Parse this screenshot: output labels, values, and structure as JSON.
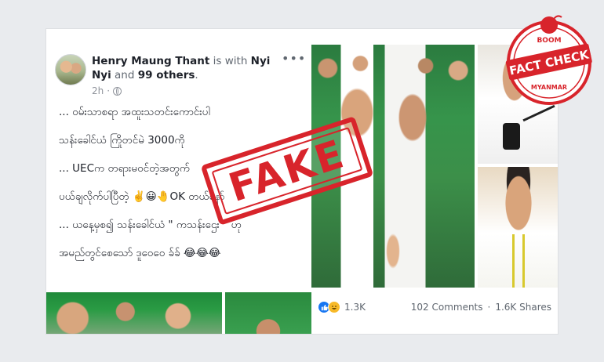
{
  "post": {
    "author": "Henry Maung Thant",
    "with_text": "is with",
    "tagged": "Nyi Nyi",
    "and_text": "and",
    "others": "99 others",
    "period": ".",
    "time": "2h",
    "more_label": "•••",
    "lines": [
      "... ဝမ်းသာစရာ အထူးသတင်းကောင်းပါ",
      "သန်းခေါင်ယံ ကြိုတင်မဲ 3000ကို",
      "... UECက တရားမဝင်တဲ့အတွက်",
      "ပယ်ချလိုက်ပါပြီတဲ့ ✌️😀🤚OK တယ်နော်",
      "...  ယနေ့မှစ၍ သန်းခေါင်ယံ  \" ကသန်းဌေး \" ဟု",
      "အမည်တွင်စေသော် ဒူဝေဝေ  ခ်ခ်  😂😂😂"
    ]
  },
  "stats": {
    "reactions": "1.3K",
    "comments": "102 Comments",
    "dot": "·",
    "shares": "1.6K Shares"
  },
  "icons": {
    "like": "like-icon",
    "haha": "haha-icon",
    "globe": "globe-icon"
  },
  "stamp": {
    "text": "FAKE",
    "color": "#d8242b"
  },
  "badge": {
    "top": "BOOM",
    "main": "FACT CHECK",
    "bottom": "MYANMAR",
    "color": "#d8242b"
  }
}
